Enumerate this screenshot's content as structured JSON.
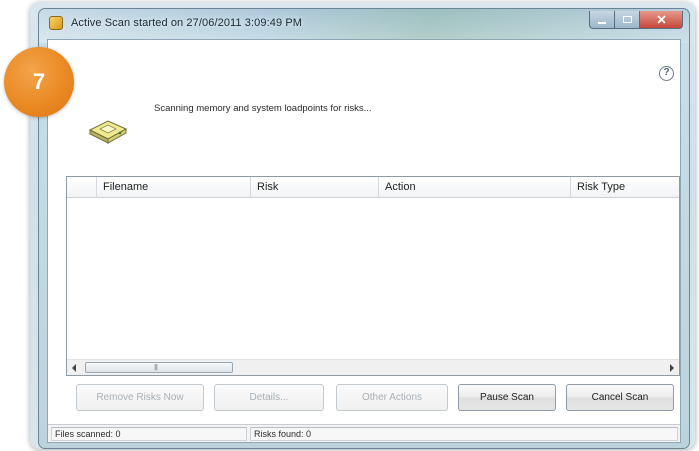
{
  "window": {
    "title": "Active Scan started on 27/06/2011 3:09:49 PM"
  },
  "step_badge": "7",
  "help_icon_glyph": "?",
  "status_message": "Scanning memory and system loadpoints for risks...",
  "results_table": {
    "columns": [
      "",
      "Filename",
      "Risk",
      "Action",
      "Risk Type"
    ],
    "rows": []
  },
  "scrollbar": {
    "grip": "|||"
  },
  "buttons": {
    "remove": "Remove Risks Now",
    "details": "Details...",
    "other_actions": "Other Actions",
    "pause": "Pause Scan",
    "cancel": "Cancel Scan"
  },
  "statusbar": {
    "files_scanned": "Files scanned: 0",
    "risks_found": "Risks found: 0"
  },
  "colors": {
    "badge": "#ea8a24",
    "close_button": "#c6463a",
    "window_frame": "#a9c6d8"
  },
  "icons": [
    "app-icon",
    "help-icon",
    "scan-drive-icon",
    "scroll-left-arrow-icon",
    "scroll-right-arrow-icon"
  ]
}
